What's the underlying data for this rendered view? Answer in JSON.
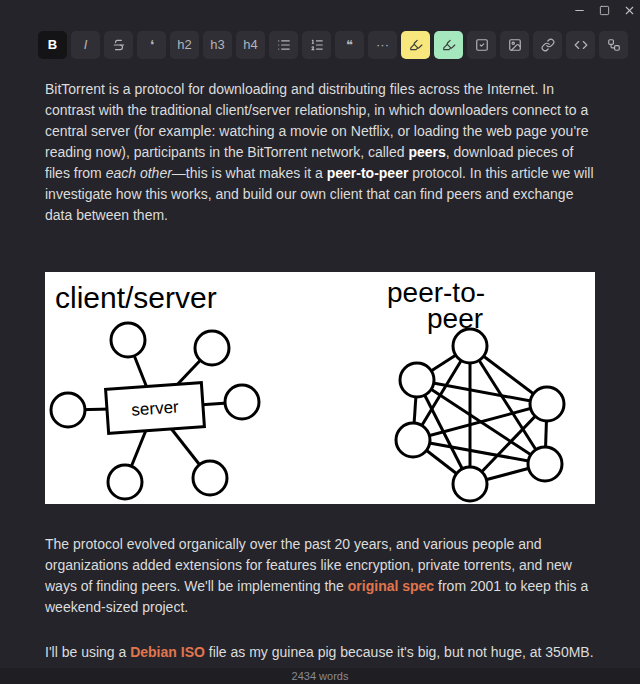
{
  "toolbar": [
    {
      "kind": "bold",
      "label": "B",
      "selected": true
    },
    {
      "kind": "italic",
      "label": "I",
      "selected": false
    },
    {
      "kind": "strikethrough",
      "selected": false
    },
    {
      "kind": "text",
      "label": "❛",
      "selected": false
    },
    {
      "kind": "text",
      "label": "h2",
      "selected": false
    },
    {
      "kind": "text",
      "label": "h3",
      "selected": false
    },
    {
      "kind": "text",
      "label": "h4",
      "selected": false
    },
    {
      "kind": "bullets",
      "selected": false
    },
    {
      "kind": "numbers",
      "selected": false
    },
    {
      "kind": "text",
      "label": "❝",
      "selected": false
    },
    {
      "kind": "text",
      "label": "···",
      "selected": false
    },
    {
      "kind": "highlight",
      "color": "#f7e77c",
      "selected": false
    },
    {
      "kind": "highlight",
      "color": "#a6e8bd",
      "selected": false
    },
    {
      "kind": "checkbox",
      "selected": false
    },
    {
      "kind": "image",
      "selected": false
    },
    {
      "kind": "link",
      "selected": false
    },
    {
      "kind": "code",
      "selected": false
    },
    {
      "kind": "diagram",
      "selected": false
    }
  ],
  "document": {
    "blocks": [
      {
        "kind": "paragraph",
        "spans": [
          {
            "style": "plain",
            "text": "BitTorrent is a protocol for downloading and distributing files across the Internet. In contrast with the traditional client/server relationship, in which downloaders connect to a central server (for example: watching a movie on Netflix, or loading the web page you're reading now), participants in the BitTorrent network, called "
          },
          {
            "style": "bold",
            "text": "peers"
          },
          {
            "style": "plain",
            "text": ", download pieces of files from "
          },
          {
            "style": "italic",
            "text": "each other"
          },
          {
            "style": "plain",
            "text": "—this is what makes it a "
          },
          {
            "style": "bold",
            "text": "peer-to-peer"
          },
          {
            "style": "plain",
            "text": " protocol. In this article we will investigate how this works, and build our own client that can find peers and exchange data between them."
          }
        ]
      },
      {
        "kind": "figure",
        "client_server_label": "client/server",
        "server_label": "server",
        "peer_to_peer_label": [
          "peer-to-",
          "peer"
        ]
      },
      {
        "kind": "paragraph",
        "spans": [
          {
            "style": "plain",
            "text": "The protocol evolved organically over the past 20 years, and various people and organizations added extensions for features like encryption, private torrents, and new ways of finding peers. We'll be implementing the "
          },
          {
            "style": "link",
            "text": "original spec"
          },
          {
            "style": "plain",
            "text": " from 2001 to keep this a weekend-sized project."
          }
        ]
      },
      {
        "kind": "paragraph",
        "spans": [
          {
            "style": "plain",
            "text": "I'll be using a "
          },
          {
            "style": "link",
            "text": "Debian ISO"
          },
          {
            "style": "plain",
            "text": " file as my guinea pig because it's big, but not huge, at 350MB."
          }
        ]
      }
    ]
  },
  "status_bar": {
    "word_count": "2434 words"
  }
}
